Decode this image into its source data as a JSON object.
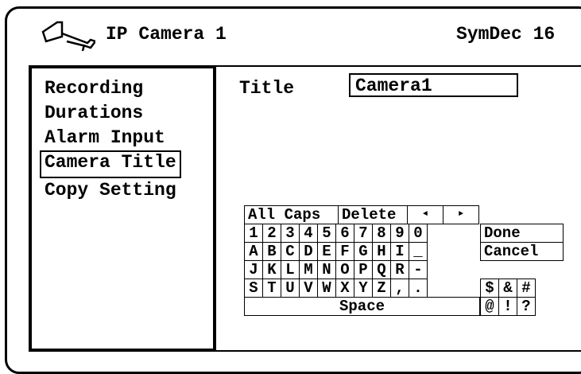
{
  "header": {
    "title": "IP Camera 1",
    "date": "SymDec 16",
    "icon": "camera-icon"
  },
  "sidebar": {
    "items": [
      {
        "label": "Recording"
      },
      {
        "label": "Durations"
      },
      {
        "label": "Alarm Input"
      },
      {
        "label": "Camera Title",
        "selected": true
      },
      {
        "label": "Copy Setting"
      }
    ]
  },
  "form": {
    "title_label": "Title",
    "title_value": "Camera1"
  },
  "keyboard": {
    "top": {
      "all_caps": "All Caps",
      "delete": "Delete",
      "left": "◄",
      "right": "►"
    },
    "rows": [
      [
        "1",
        "2",
        "3",
        "4",
        "5",
        "6",
        "7",
        "8",
        "9",
        "0"
      ],
      [
        "A",
        "B",
        "C",
        "D",
        "E",
        "F",
        "G",
        "H",
        "I",
        "_"
      ],
      [
        "J",
        "K",
        "L",
        "M",
        "N",
        "O",
        "P",
        "Q",
        "R",
        "-"
      ],
      [
        "S",
        "T",
        "U",
        "V",
        "W",
        "X",
        "Y",
        "Z",
        ",",
        "."
      ]
    ],
    "symbols_row1": [
      "$",
      "&",
      "#"
    ],
    "symbols_row2": [
      "@",
      "!",
      "?"
    ],
    "done": "Done",
    "cancel": "Cancel",
    "space": "Space"
  }
}
